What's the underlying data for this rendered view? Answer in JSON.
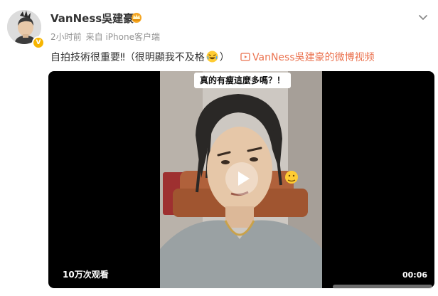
{
  "post": {
    "author": {
      "name": "VanNess吳建豪",
      "badge_icon": "crown-badge-icon",
      "verified_color": "#f7b500"
    },
    "meta": {
      "time": "2小时前",
      "source": "来自 iPhone客户端"
    },
    "text": {
      "main": "自拍技術很重要‼（很明顯我不及格",
      "after_emoji": "）",
      "emoji_icon": "laughing-emoji-icon"
    },
    "video_link": {
      "label": "VanNess吳建豪的微博视频",
      "color": "#eb7350"
    },
    "video": {
      "overlay_caption": "真的有瘦這麼多嗎？！",
      "view_count": "10万次观看",
      "duration": "00:06"
    }
  },
  "colors": {
    "link": "#eb7350",
    "meta": "#939393",
    "text": "#333333",
    "video_bg": "#000000"
  }
}
